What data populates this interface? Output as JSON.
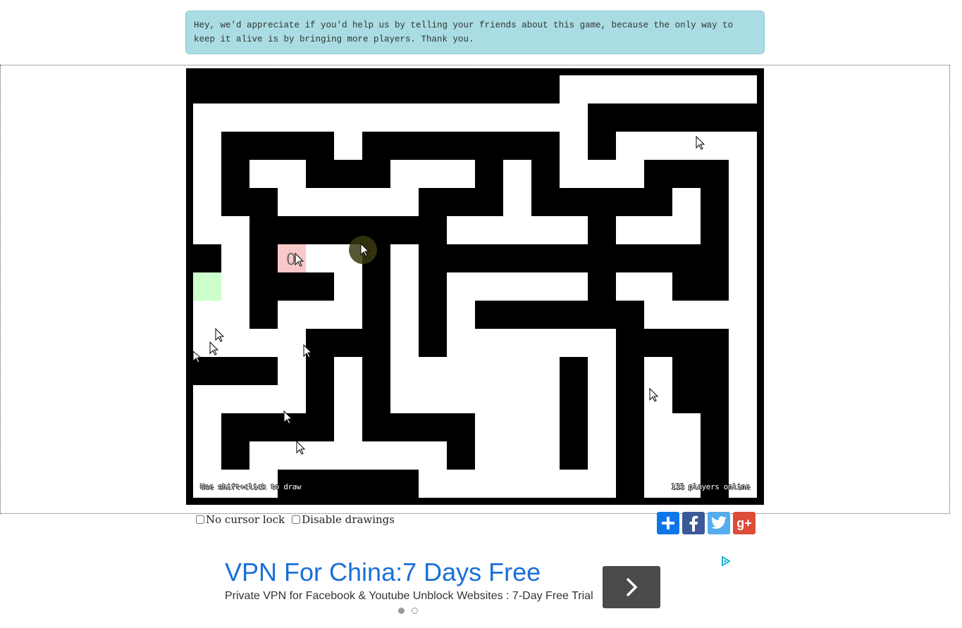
{
  "notice": "Hey, we'd appreciate if you'd help us by telling your friends about this game, because the only way to keep it alive is by bringing more players. Thank you.",
  "maze": {
    "hint_left": "Use shift+click to draw",
    "hint_right": "133 players online",
    "player_level": "0",
    "colors": {
      "wall": "#000000",
      "path": "#ffffff",
      "goal": "#ccffcc",
      "player_tile": "#f9c8c8"
    }
  },
  "options": {
    "no_cursor_lock": "No cursor lock",
    "disable_drawings": "Disable drawings"
  },
  "share": {
    "icons": [
      "add-icon",
      "facebook-icon",
      "twitter-icon",
      "google-plus-icon"
    ],
    "colors": [
      "#0e76e8",
      "#3b5998",
      "#55acee",
      "#dd4b39"
    ]
  },
  "ad": {
    "title": "VPN For China:7 Days Free",
    "description": "Private VPN for Facebook & Youtube Unblock Websites : 7-Day Free Trial"
  }
}
